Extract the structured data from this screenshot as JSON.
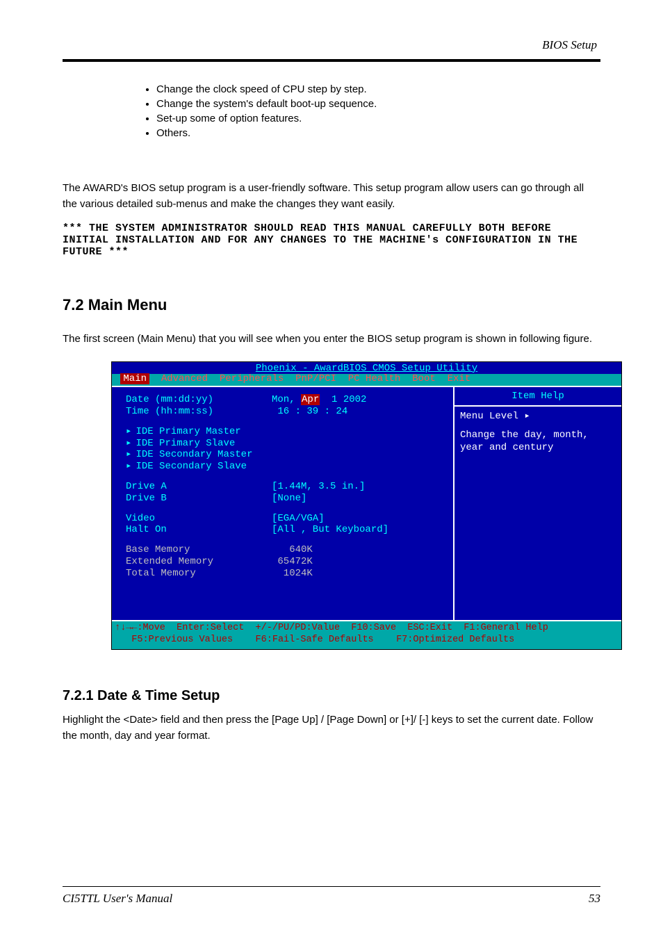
{
  "header": {
    "right": "BIOS Setup"
  },
  "bullets": [
    "Change the clock speed of CPU step by step.",
    "Change the system's default boot-up sequence.",
    "Set-up some of option features.",
    "Others."
  ],
  "para1": "The AWARD's BIOS setup program is a user-friendly software. This setup program allow users can go through all the various detailed sub-menus and make the changes they want easily.",
  "stars": "*** THE SYSTEM ADMINISTRATOR SHOULD READ THIS MANUAL CAREFULLY BOTH BEFORE INITIAL INSTALLATION AND FOR ANY CHANGES TO THE MACHINE's CONFIGURATION IN THE FUTURE ***",
  "heading1": "7.2 Main Menu",
  "subpara": "The first screen (Main Menu) that you will see when you enter the BIOS setup program is shown in following figure.",
  "bios": {
    "title": "Phoenix - AwardBIOS CMOS Setup Utility",
    "menus": [
      "Main",
      "Advanced",
      "Peripherals",
      "PnP/PCI",
      "PC Health",
      "Boot",
      "Exit"
    ],
    "rows": {
      "date_label": "Date (mm:dd:yy)",
      "date_prefix": "Mon, ",
      "date_hl": "Apr",
      "date_suffix": "  1 2002",
      "time_label": "Time (hh:mm:ss)",
      "time_value": " 16 : 39 : 24",
      "ide1": "IDE Primary Master",
      "ide2": "IDE Primary Slave",
      "ide3": "IDE Secondary Master",
      "ide4": "IDE Secondary Slave",
      "driveA_label": "Drive A",
      "driveA_val": "[1.44M, 3.5 in.]",
      "driveB_label": "Drive B",
      "driveB_val": "[None]",
      "video_label": "Video",
      "video_val": "[EGA/VGA]",
      "halt_label": "Halt On",
      "halt_val": "[All , But Keyboard]",
      "base_label": "Base Memory",
      "base_val": "   640K",
      "ext_label": "Extended Memory",
      "ext_val": " 65472K",
      "tot_label": "Total Memory",
      "tot_val": "  1024K"
    },
    "help": {
      "title": "Item Help",
      "menu_level": "Menu Level   ▸",
      "desc": "Change the day, month, year and century"
    },
    "footer1": "↑↓→←:Move  Enter:Select  +/-/PU/PD:Value  F10:Save  ESC:Exit  F1:General Help",
    "footer2": "   F5:Previous Values    F6:Fail-Safe Defaults    F7:Optimized Defaults"
  },
  "heading2": "7.2.1 Date & Time Setup",
  "para2": "Highlight the <Date> field and then press the [Page Up] / [Page Down] or [+]/ [-] keys to set the current date. Follow the month, day and year format.",
  "footer": {
    "left": "CI5TTL User's Manual",
    "right": "53"
  }
}
